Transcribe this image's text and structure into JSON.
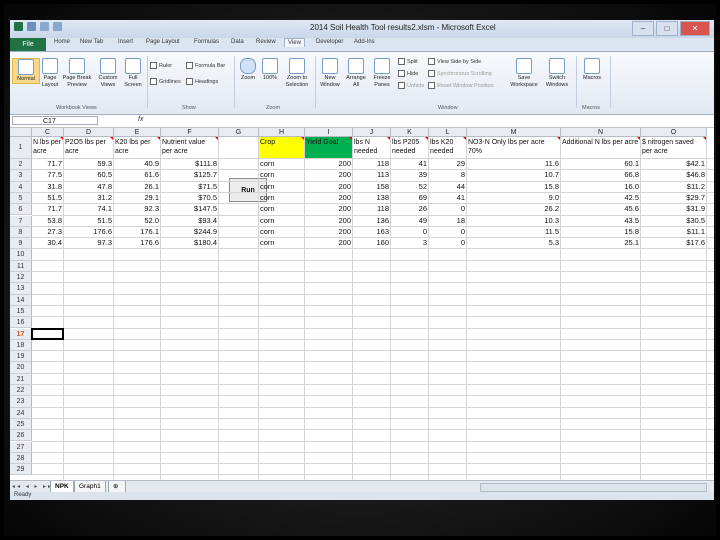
{
  "window": {
    "title": "2014 Soil Health Tool results2.xlsm - Microsoft Excel"
  },
  "ribbon_tabs": [
    "File",
    "Home",
    "New Tab",
    "Insert",
    "Page Layout",
    "Formulas",
    "Data",
    "Review",
    "View",
    "Developer",
    "Add-Ins"
  ],
  "active_ribbon_tab": "View",
  "ribbon": {
    "workbook_views": {
      "label": "Workbook Views",
      "normal": "Normal",
      "page_layout": "Page Layout",
      "page_break": "Page Break Preview",
      "custom_views": "Custom Views",
      "full_screen": "Full Screen"
    },
    "show": {
      "label": "Show",
      "ruler": "Ruler",
      "gridlines": "Gridlines",
      "formula_bar": "Formula Bar",
      "headings": "Headings"
    },
    "zoom": {
      "label": "Zoom",
      "zoom": "Zoom",
      "hundred": "100%",
      "zoom_selection": "Zoom to Selection"
    },
    "window": {
      "label": "Window",
      "new_window": "New Window",
      "arrange_all": "Arrange All",
      "freeze_panes": "Freeze Panes",
      "split": "Split",
      "hide": "Hide",
      "unhide": "Unhide",
      "side_by_side": "View Side by Side",
      "sync_scroll": "Synchronous Scrolling",
      "reset_position": "Reset Window Position",
      "save_workspace": "Save Workspace",
      "switch_windows": "Switch Windows"
    },
    "macros": {
      "label": "Macros",
      "macros": "Macros"
    }
  },
  "formula_bar": {
    "name_box": "C17",
    "fx": "fx",
    "formula": ""
  },
  "columns": [
    "C",
    "D",
    "E",
    "F",
    "G",
    "H",
    "I",
    "J",
    "K",
    "L",
    "M",
    "N",
    "O"
  ],
  "selected_cell": {
    "col": "C",
    "row": 17
  },
  "header_row": [
    "N lbs per acre",
    "P2O5 lbs per acre",
    "K20 lbs per acre",
    "Nutrient value per acre",
    "",
    "Crop",
    "Yield Goal",
    "lbs N needed",
    "lbs P205 needed",
    "lbs K20 needed",
    "NO3-N Only lbs per acre 70%",
    "Additional N lbs per acre",
    "$ nitrogen saved per acre"
  ],
  "rows": [
    [
      "71.7",
      "59.3",
      "40.9",
      "$111.8",
      "",
      "corn",
      "200",
      "118",
      "41",
      "29",
      "11.6",
      "60.1",
      "$42.1"
    ],
    [
      "77.5",
      "60.5",
      "61.6",
      "$125.7",
      "",
      "corn",
      "200",
      "113",
      "39",
      "8",
      "10.7",
      "66.8",
      "$46.8"
    ],
    [
      "31.8",
      "47.8",
      "26.1",
      "$71.5",
      "",
      "corn",
      "200",
      "158",
      "52",
      "44",
      "15.8",
      "16.0",
      "$11.2"
    ],
    [
      "51.5",
      "31.2",
      "29.1",
      "$70.5",
      "",
      "corn",
      "200",
      "138",
      "69",
      "41",
      "9.0",
      "42.5",
      "$29.7"
    ],
    [
      "71.7",
      "74.1",
      "92.3",
      "$147.5",
      "",
      "corn",
      "200",
      "118",
      "26",
      "0",
      "26.2",
      "45.6",
      "$31.9"
    ],
    [
      "53.8",
      "51.5",
      "52.0",
      "$93.4",
      "",
      "corn",
      "200",
      "136",
      "49",
      "18",
      "10.3",
      "43.5",
      "$30.5"
    ],
    [
      "27.3",
      "176.6",
      "176.1",
      "$244.9",
      "",
      "corn",
      "200",
      "163",
      "0",
      "0",
      "11.5",
      "15.8",
      "$11.1"
    ],
    [
      "30.4",
      "97.3",
      "176.6",
      "$180.4",
      "",
      "corn",
      "200",
      "160",
      "3",
      "0",
      "5.3",
      "25.1",
      "$17.6"
    ]
  ],
  "row_numbers": [
    "1",
    "2",
    "3",
    "4",
    "5",
    "6",
    "7",
    "8",
    "9",
    "10",
    "11",
    "12",
    "13",
    "14",
    "15",
    "16",
    "17",
    "18",
    "19",
    "20",
    "21",
    "22",
    "23",
    "24",
    "25",
    "26",
    "27",
    "28",
    "29"
  ],
  "run_button": "Run",
  "sheet_tabs": [
    "NPK",
    "Graph1"
  ],
  "active_sheet": "NPK",
  "status": "Ready"
}
